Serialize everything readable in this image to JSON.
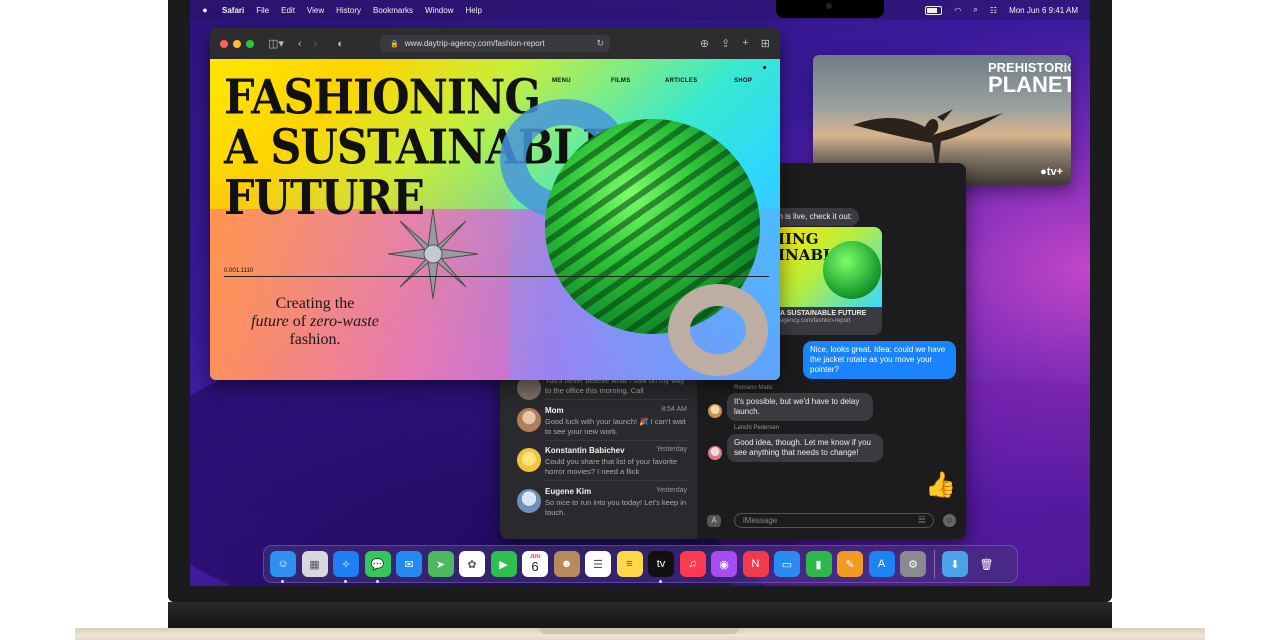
{
  "menubar": {
    "app_name": "Safari",
    "menus": [
      "File",
      "Edit",
      "View",
      "History",
      "Bookmarks",
      "Window",
      "Help"
    ],
    "clock": "Mon Jun 6  9:41 AM"
  },
  "safari": {
    "url": "www.daytrip-agency.com/fashion-report",
    "page": {
      "nav": [
        "MENU",
        "FILMS",
        "ARTICLES",
        "SHOP"
      ],
      "headline": [
        "FASHIONING",
        "A SUSTAINABLE",
        "FUTURE"
      ],
      "code": "0.001.1110",
      "tagline_1": "Creating the",
      "tagline_2a": "future",
      "tagline_2b": " of ",
      "tagline_2c": "zero-waste",
      "tagline_3": "fashion."
    }
  },
  "tv": {
    "title_small": "PREHISTORIC",
    "title_big": "PLANET",
    "brand": "tv+"
  },
  "messages": {
    "conversations": [
      {
        "name": "",
        "time": "",
        "preview": "You'll never believe what I saw on my way to the office this morning. Call"
      },
      {
        "name": "Mom",
        "time": "8:54 AM",
        "preview": "Good luck with your launch! 🎉 I can't wait to see your new work."
      },
      {
        "name": "Konstantin Babichev",
        "time": "Yesterday",
        "preview": "Could you share that list of your favorite horror movies? I need a flick"
      },
      {
        "name": "Eugene Kim",
        "time": "Yesterday",
        "preview": "So nice to run into you today! Let's keep in touch."
      }
    ],
    "chat": {
      "msg_first": "en is live, check it out:",
      "link_title": "A SUSTAINABLE FUTURE",
      "link_url": "agency.com/fashion-report",
      "link_headline": [
        "IING",
        "INABL"
      ],
      "msg_me": "Nice, looks great. Idea: could we have the jacket rotate as you move your pointer?",
      "sender_1": "Romano Matic",
      "msg_1": "It's possible, but we'd have to delay launch.",
      "sender_2": "Lanchi Pedersen",
      "msg_2": "Good idea, though. Let me know if you see anything that needs to change!",
      "emoji": "👍",
      "input_placeholder": "iMessage"
    }
  },
  "dock": {
    "apps": [
      {
        "name": "Finder",
        "color": "#2f8ff0",
        "glyph": "☺"
      },
      {
        "name": "Launchpad",
        "color": "#d7d7dd",
        "glyph": "▦"
      },
      {
        "name": "Safari",
        "color": "#1e7ff5",
        "glyph": "✧"
      },
      {
        "name": "Messages",
        "color": "#34c759",
        "glyph": "💬"
      },
      {
        "name": "Mail",
        "color": "#2489f0",
        "glyph": "✉"
      },
      {
        "name": "Maps",
        "color": "#4cb860",
        "glyph": "➤"
      },
      {
        "name": "Photos",
        "color": "#ffffff",
        "glyph": "✿"
      },
      {
        "name": "FaceTime",
        "color": "#2ec04c",
        "glyph": "▶"
      },
      {
        "name": "Calendar",
        "color": "#ffffff",
        "glyph": "6"
      },
      {
        "name": "Contacts",
        "color": "#b78a5c",
        "glyph": "☻"
      },
      {
        "name": "Reminders",
        "color": "#ffffff",
        "glyph": "☰"
      },
      {
        "name": "Notes",
        "color": "#ffd84a",
        "glyph": "≡"
      },
      {
        "name": "TV",
        "color": "#111111",
        "glyph": "tv"
      },
      {
        "name": "Music",
        "color": "#fa3b4f",
        "glyph": "♫"
      },
      {
        "name": "Podcasts",
        "color": "#a64cf0",
        "glyph": "◉"
      },
      {
        "name": "News",
        "color": "#f23a4d",
        "glyph": "N"
      },
      {
        "name": "Keynote",
        "color": "#2a8cf0",
        "glyph": "▭"
      },
      {
        "name": "Numbers",
        "color": "#2fb84a",
        "glyph": "▮"
      },
      {
        "name": "Pages",
        "color": "#f39a22",
        "glyph": "✎"
      },
      {
        "name": "App Store",
        "color": "#1b84f5",
        "glyph": "A"
      },
      {
        "name": "System Preferences",
        "color": "#8a8a90",
        "glyph": "⚙"
      }
    ],
    "calendar_month": "JUN",
    "folder_glyph": "⬇",
    "trash_glyph": "🗑"
  }
}
